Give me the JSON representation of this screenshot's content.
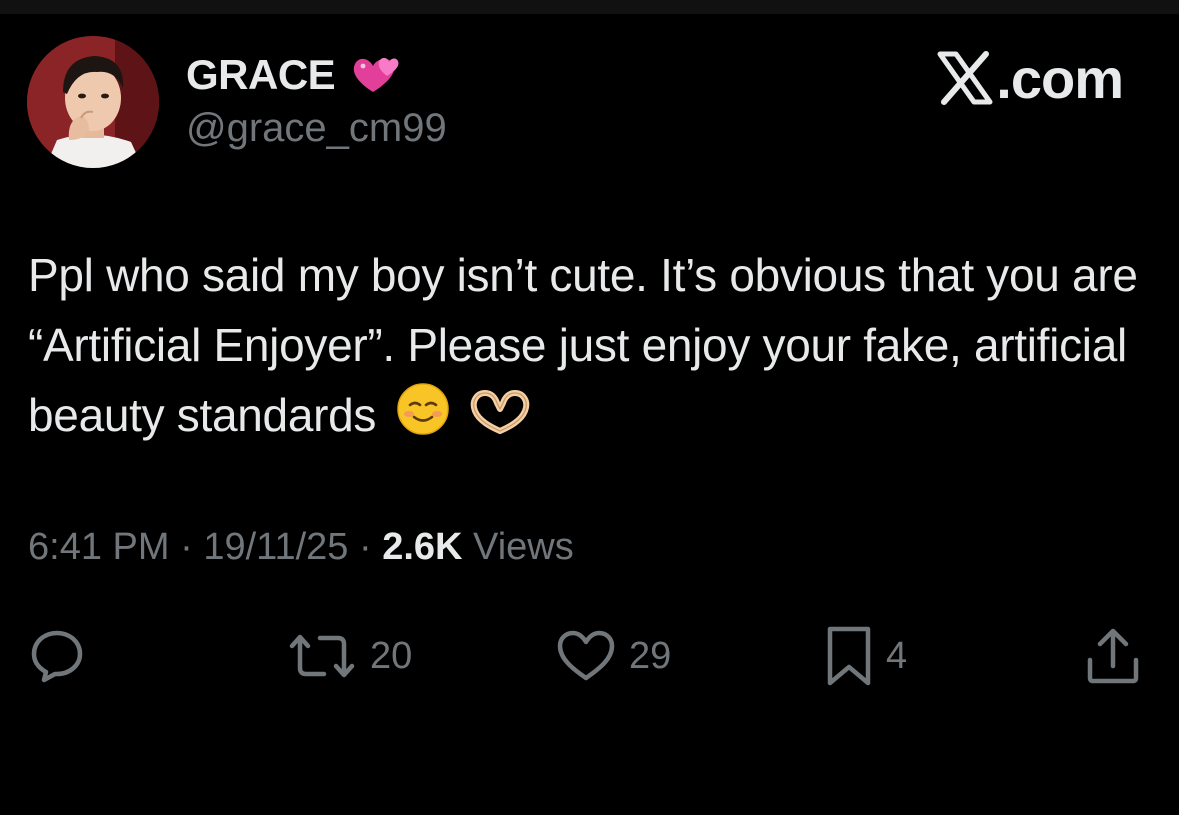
{
  "header": {
    "display_name": "GRACE",
    "handle": "@grace_cm99",
    "brand": ".com"
  },
  "tweet": {
    "text": "Ppl who said my boy isn’t cute. It’s obvious that you are “Artificial Enjoyer”. Please just enjoy your fake, artificial beauty standards"
  },
  "meta": {
    "time": "6:41 PM",
    "sep1": " · ",
    "date": "19/11/25",
    "sep2": " · ",
    "views_count": "2.6K",
    "views_label": " Views"
  },
  "actions": {
    "reply_count": "",
    "retweet_count": "20",
    "like_count": "29",
    "bookmark_count": "4"
  },
  "icons": {
    "reply": "reply-icon",
    "retweet": "retweet-icon",
    "like": "heart-outline-icon",
    "bookmark": "bookmark-icon",
    "share": "share-icon",
    "emoji_after_name": "two-hearts-emoji",
    "emoji_1": "smiling-face-emoji",
    "emoji_2": "heart-hands-emoji"
  },
  "colors": {
    "background": "#000000",
    "text_primary": "#e7e9ea",
    "text_secondary": "#71767b",
    "heart_pink": "#f25fb8"
  }
}
